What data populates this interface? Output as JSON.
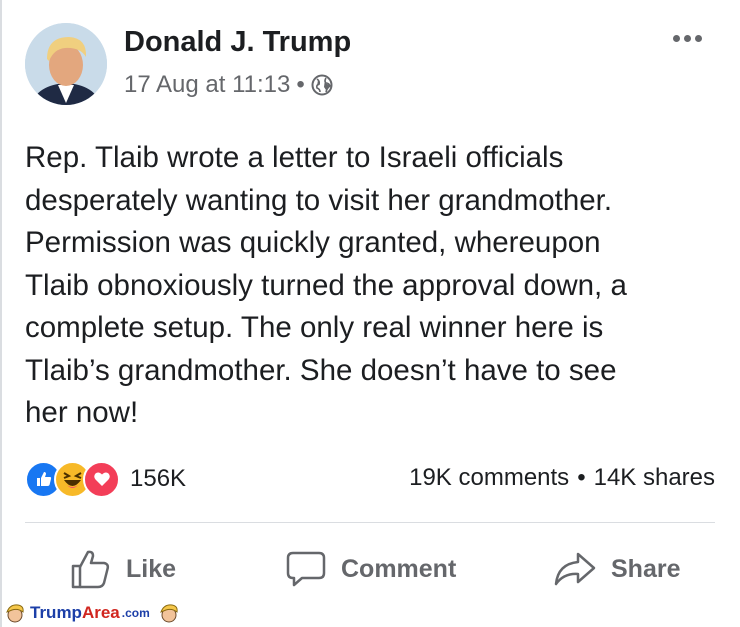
{
  "post": {
    "author": "Donald J. Trump",
    "timestamp": "17 Aug at 11:13",
    "separator": "•",
    "privacy_icon": "globe-icon",
    "text": "Rep. Tlaib wrote a letter to Israeli officials\ndesperately wanting to visit her grandmother.\nPermission was quickly granted, whereupon\nTlaib obnoxiously turned the approval down, a\ncomplete setup. The only real winner here is\nTlaib’s grandmother. She doesn’t have to see\nher now!"
  },
  "reactions": {
    "icons": [
      "like-reaction-icon",
      "haha-reaction-icon",
      "love-reaction-icon"
    ],
    "count": "156K"
  },
  "stats": {
    "comments": "19K comments",
    "separator": "•",
    "shares": "14K shares"
  },
  "actions": {
    "like": "Like",
    "comment": "Comment",
    "share": "Share"
  },
  "watermark": {
    "trump": "Trump",
    "area": "Area",
    "com": ".com"
  },
  "colors": {
    "like_blue": "#1877f2",
    "love_red": "#f33e58",
    "haha_yellow": "#f7b928",
    "secondary_text": "#65676b"
  }
}
